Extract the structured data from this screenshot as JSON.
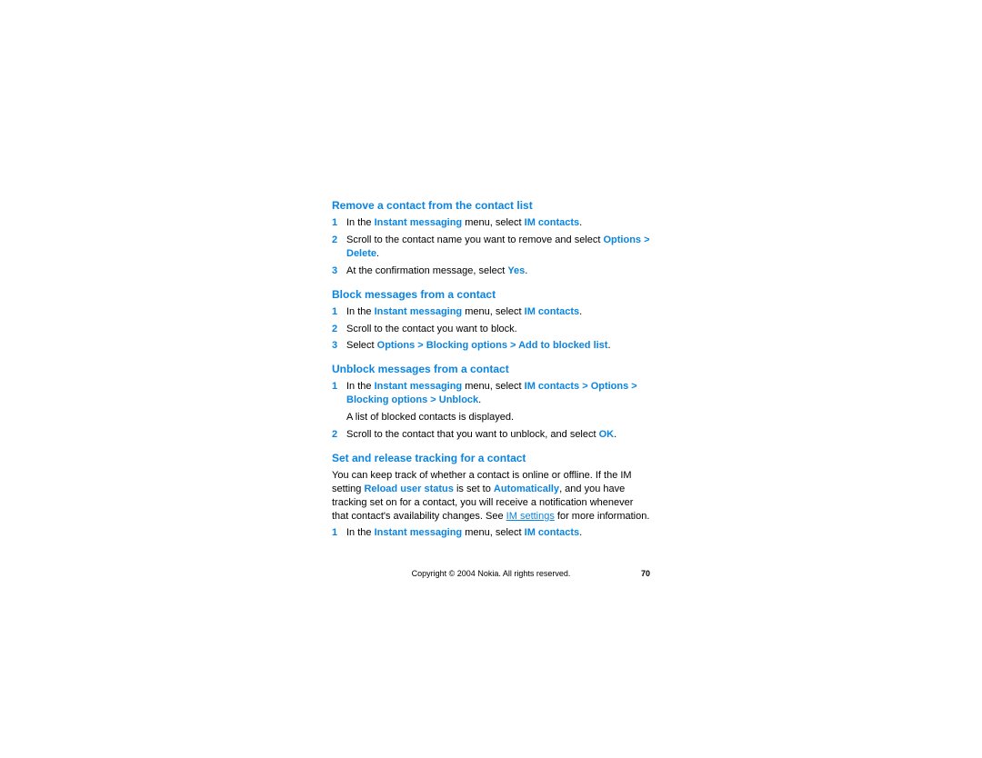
{
  "sections": {
    "remove": {
      "heading": "Remove a contact from the contact list",
      "step1_pre": "In the ",
      "step1_link1": "Instant messaging",
      "step1_mid": " menu, select ",
      "step1_link2": "IM contacts",
      "step1_end": ".",
      "step2_pre": "Scroll to the contact name you want to remove and select ",
      "step2_link": "Options > Delete",
      "step2_end": ".",
      "step3_pre": "At the confirmation message, select ",
      "step3_link": "Yes",
      "step3_end": "."
    },
    "block": {
      "heading": "Block messages from a contact",
      "step1_pre": "In the ",
      "step1_link1": "Instant messaging",
      "step1_mid": " menu, select ",
      "step1_link2": "IM contacts",
      "step1_end": ".",
      "step2": "Scroll to the contact you want to block.",
      "step3_pre": "Select ",
      "step3_link": "Options > Blocking options > Add to blocked list",
      "step3_end": "."
    },
    "unblock": {
      "heading": "Unblock messages from a contact",
      "step1_pre": "In the ",
      "step1_link1": "Instant messaging",
      "step1_mid": " menu, select ",
      "step1_link2": "IM contacts > Options > Blocking options > Unblock",
      "step1_end": ".",
      "note": "A list of blocked contacts is displayed.",
      "step2_pre": "Scroll to the contact that you want to unblock, and select ",
      "step2_link": "OK",
      "step2_end": "."
    },
    "tracking": {
      "heading": "Set and release tracking for a contact",
      "para_pre": "You can keep track of whether a contact is online or offline. If the IM setting ",
      "para_link1": "Reload user status",
      "para_mid1": " is set to ",
      "para_link2": "Automatically",
      "para_mid2": ", and you have tracking set on for a contact, you will receive a notification whenever that contact's availability changes. See ",
      "para_link3": "IM settings",
      "para_end": " for more information.",
      "step1_pre": "In the ",
      "step1_link1": "Instant messaging",
      "step1_mid": " menu, select ",
      "step1_link2": "IM contacts",
      "step1_end": "."
    }
  },
  "nums": {
    "n1": "1",
    "n2": "2",
    "n3": "3"
  },
  "footer": {
    "copyright": "Copyright © 2004 Nokia. All rights reserved.",
    "page": "70"
  }
}
